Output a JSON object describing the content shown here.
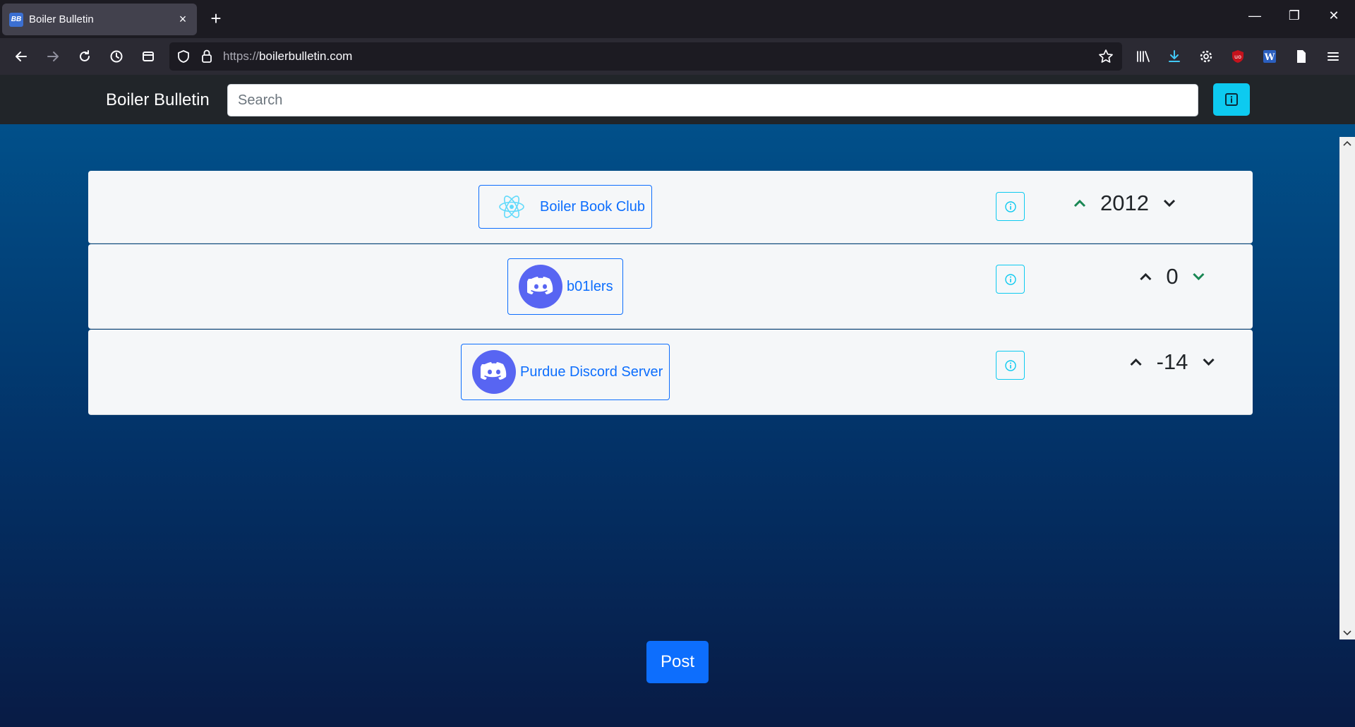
{
  "browser": {
    "tab_title": "Boiler Bulletin",
    "tab_favicon_text": "BB",
    "close_glyph": "×",
    "new_tab_glyph": "+",
    "url_scheme": "https://",
    "url_host": "boilerbulletin.com",
    "window_controls": [
      "—",
      "❐",
      "✕"
    ]
  },
  "header": {
    "brand": "Boiler Bulletin",
    "search_placeholder": "Search"
  },
  "posts": [
    {
      "label": "Boiler Book Club",
      "icon": "react-icon",
      "votes": "2012",
      "vote_state": "up"
    },
    {
      "label": "b01lers",
      "icon": "discord-icon",
      "votes": "0",
      "vote_state": "down"
    },
    {
      "label": "Purdue Discord Server",
      "icon": "discord-icon",
      "votes": "-14",
      "vote_state": "none"
    }
  ],
  "post_button": "Post",
  "colors": {
    "primary": "#0d6efd",
    "info": "#0dcaf0",
    "vote_active": "#198754",
    "discord": "#5865f2",
    "react": "#61dafb"
  }
}
